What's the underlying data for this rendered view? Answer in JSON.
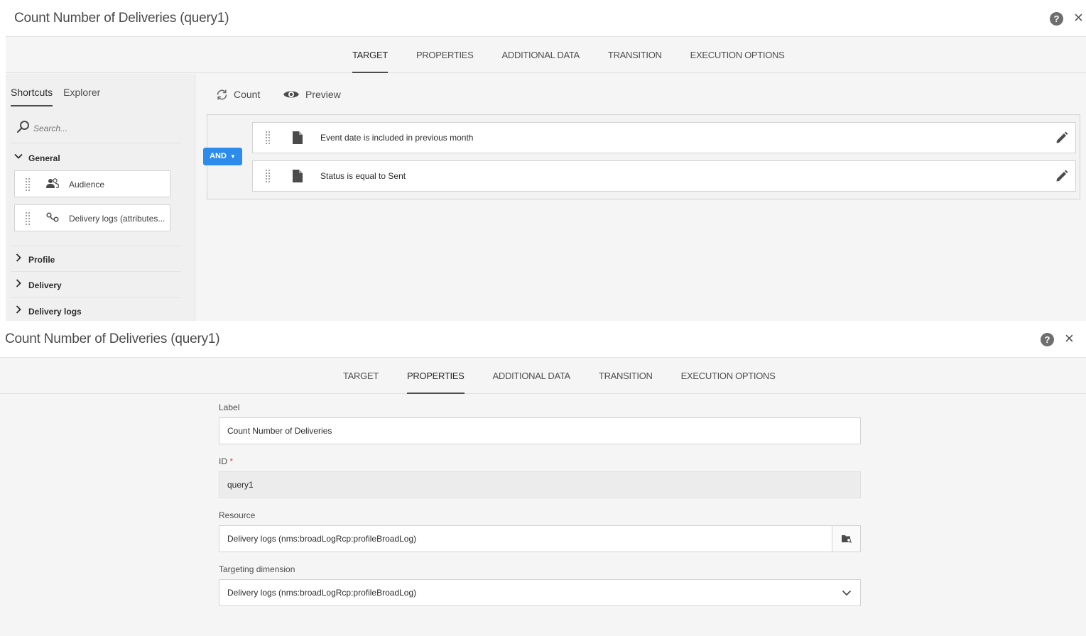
{
  "top_panel": {
    "title": "Count Number of Deliveries (query1)",
    "tabs": [
      {
        "label": "TARGET",
        "active": true
      },
      {
        "label": "PROPERTIES",
        "active": false
      },
      {
        "label": "ADDITIONAL DATA",
        "active": false
      },
      {
        "label": "TRANSITION",
        "active": false
      },
      {
        "label": "EXECUTION OPTIONS",
        "active": false
      }
    ],
    "sidebar": {
      "tabs": [
        "Shortcuts",
        "Explorer"
      ],
      "search_placeholder": "Search...",
      "general_label": "General",
      "shortcuts": [
        {
          "label": "Audience",
          "icon": "audience-icon"
        },
        {
          "label": "Delivery logs (attributes...",
          "icon": "link-icon"
        }
      ],
      "groups": [
        "Profile",
        "Delivery",
        "Delivery logs"
      ]
    },
    "toolbar": {
      "count_label": "Count",
      "preview_label": "Preview"
    },
    "operator_label": "AND",
    "rules": [
      "Event date is included in previous month",
      "Status is equal to Sent"
    ]
  },
  "bottom_panel": {
    "title": "Count Number of Deliveries (query1)",
    "tabs": [
      {
        "label": "TARGET",
        "active": false
      },
      {
        "label": "PROPERTIES",
        "active": true
      },
      {
        "label": "ADDITIONAL DATA",
        "active": false
      },
      {
        "label": "TRANSITION",
        "active": false
      },
      {
        "label": "EXECUTION OPTIONS",
        "active": false
      }
    ],
    "form": {
      "label_label": "Label",
      "label_value": "Count Number of Deliveries",
      "id_label": "ID",
      "id_required_mark": "*",
      "id_value": "query1",
      "resource_label": "Resource",
      "resource_value": "Delivery logs (nms:broadLogRcp:profileBroadLog)",
      "targeting_label": "Targeting dimension",
      "targeting_value": "Delivery logs (nms:broadLogRcp:profileBroadLog)"
    }
  },
  "colors": {
    "accent": "#2d8ceb",
    "panel_bg": "#f5f5f5",
    "required": "#e34850"
  }
}
